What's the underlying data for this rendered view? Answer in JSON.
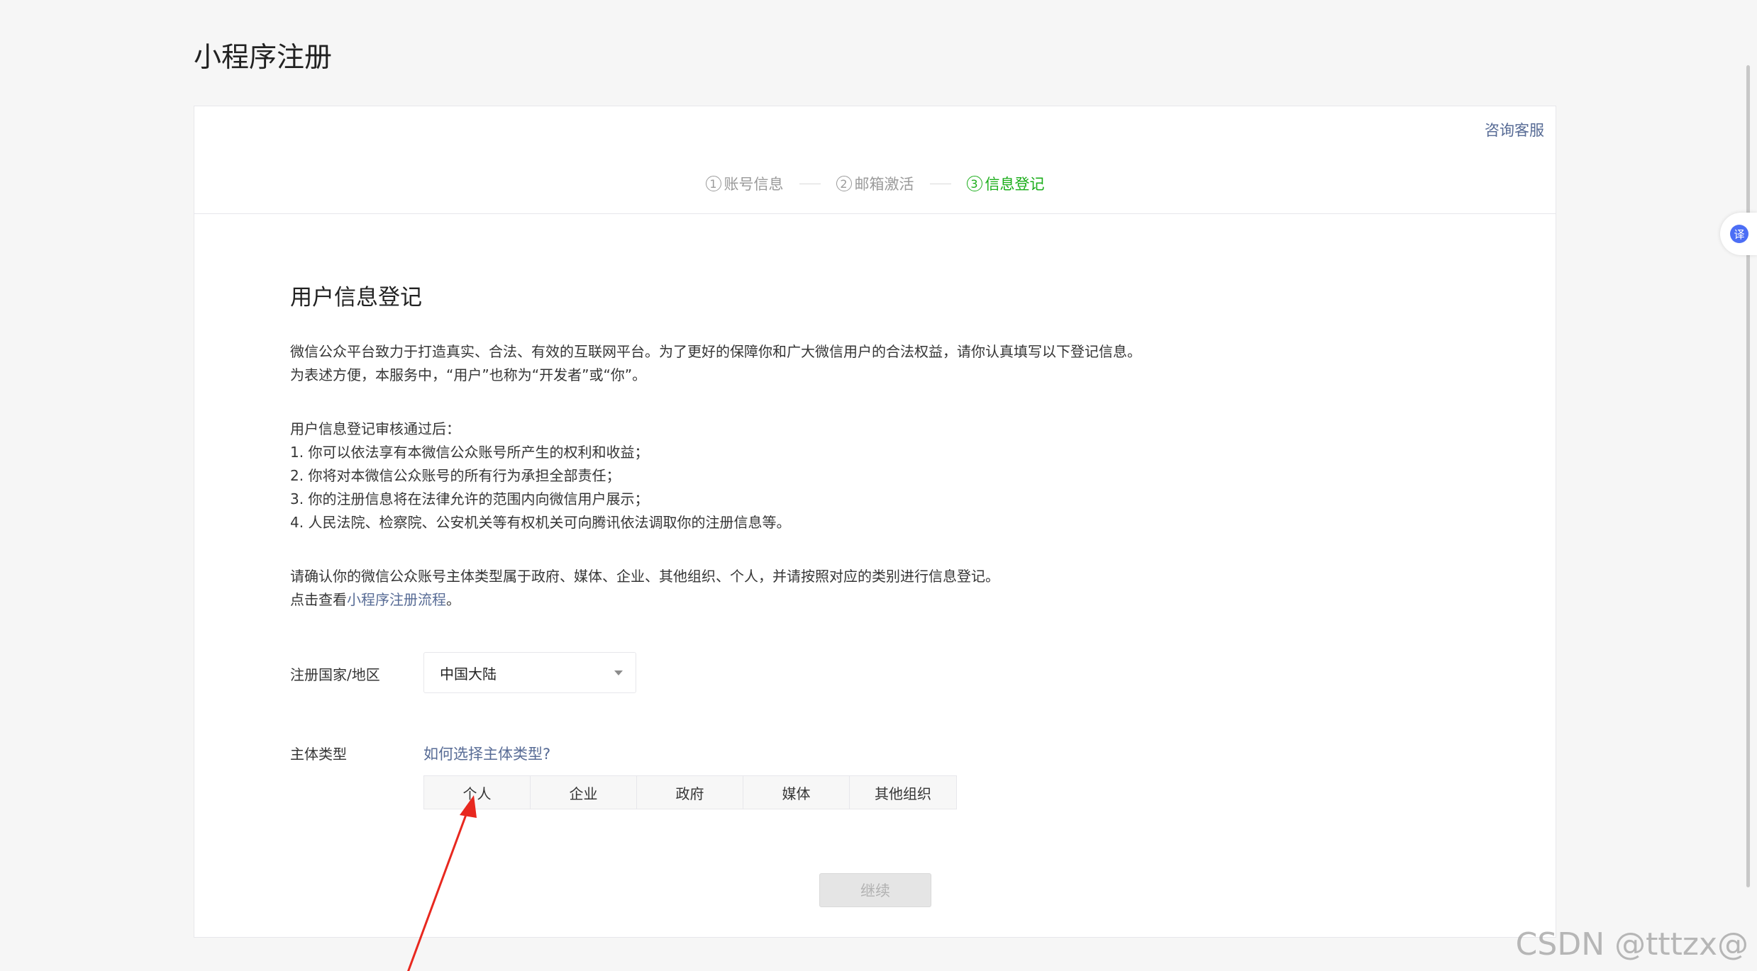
{
  "page_title": "小程序注册",
  "support_link": "咨询客服",
  "steps": [
    {
      "num": "1",
      "label": "账号信息"
    },
    {
      "num": "2",
      "label": "邮箱激活"
    },
    {
      "num": "3",
      "label": "信息登记"
    }
  ],
  "section": {
    "title": "用户信息登记",
    "intro_1": "微信公众平台致力于打造真实、合法、有效的互联网平台。为了更好的保障你和广大微信用户的合法权益，请你认真填写以下登记信息。",
    "intro_2": "为表述方便，本服务中，“用户”也称为“开发者”或“你”。",
    "list_header": "用户信息登记审核通过后：",
    "list_items": [
      "1. 你可以依法享有本微信公众账号所产生的权利和收益；",
      "2. 你将对本微信公众账号的所有行为承担全部责任；",
      "3. 你的注册信息将在法律允许的范围内向微信用户展示；",
      "4. 人民法院、检察院、公安机关等有权机关可向腾讯依法调取你的注册信息等。"
    ],
    "confirm_text": "请确认你的微信公众账号主体类型属于政府、媒体、企业、其他组织、个人，并请按照对应的类别进行信息登记。",
    "flow_prefix": "点击查看",
    "flow_link": "小程序注册流程",
    "flow_suffix": "。"
  },
  "form": {
    "region_label": "注册国家/地区",
    "region_value": "中国大陆",
    "type_label": "主体类型",
    "type_help": "如何选择主体类型?",
    "types": [
      "个人",
      "企业",
      "政府",
      "媒体",
      "其他组织"
    ]
  },
  "continue_button": "继续",
  "translate_icon": "译",
  "watermark": "CSDN @tttzx@",
  "colors": {
    "accent_green": "#1aad19",
    "link_blue": "#576b95",
    "annotation_red": "#e8281f"
  }
}
